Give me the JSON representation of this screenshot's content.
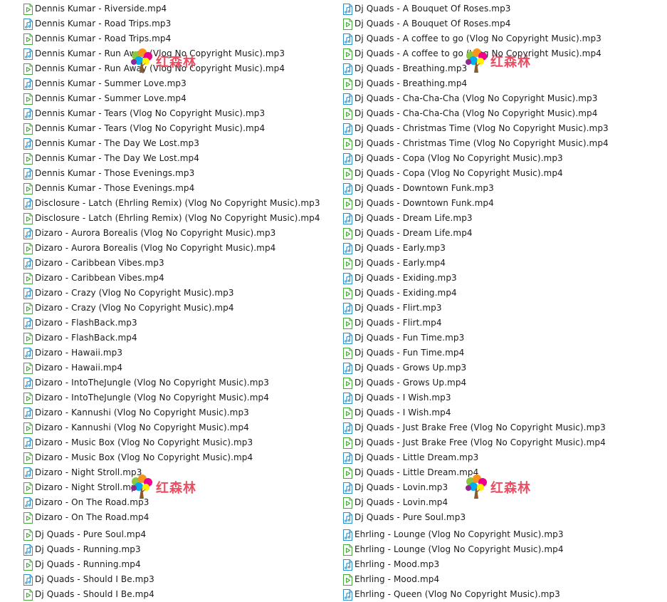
{
  "icons": {
    "mp3": "music-file-icon",
    "mp4": "video-file-icon"
  },
  "colors": {
    "mp3_icon": "#2b8fc9",
    "mp4_icon": "#46a83a",
    "watermark": "#e8455a"
  },
  "watermark_text": "红森林",
  "left_column": [
    {
      "name": "Dennis Kumar - Riverside.mp4",
      "type": "mp4"
    },
    {
      "name": "Dennis Kumar - Road Trips.mp3",
      "type": "mp3"
    },
    {
      "name": "Dennis Kumar - Road Trips.mp4",
      "type": "mp4"
    },
    {
      "name": "Dennis Kumar - Run Away (Vlog No Copyright Music).mp3",
      "type": "mp3"
    },
    {
      "name": "Dennis Kumar - Run Away (Vlog No Copyright Music).mp4",
      "type": "mp4"
    },
    {
      "name": "Dennis Kumar - Summer Love.mp3",
      "type": "mp3"
    },
    {
      "name": "Dennis Kumar - Summer Love.mp4",
      "type": "mp4"
    },
    {
      "name": "Dennis Kumar - Tears (Vlog No Copyright Music).mp3",
      "type": "mp3"
    },
    {
      "name": "Dennis Kumar - Tears (Vlog No Copyright Music).mp4",
      "type": "mp4"
    },
    {
      "name": "Dennis Kumar - The Day We Lost.mp3",
      "type": "mp3"
    },
    {
      "name": "Dennis Kumar - The Day We Lost.mp4",
      "type": "mp4"
    },
    {
      "name": "Dennis Kumar - Those Evenings.mp3",
      "type": "mp3"
    },
    {
      "name": "Dennis Kumar - Those Evenings.mp4",
      "type": "mp4"
    },
    {
      "name": "Disclosure - Latch (Ehrling Remix) (Vlog No Copyright Music).mp3",
      "type": "mp3"
    },
    {
      "name": "Disclosure - Latch (Ehrling Remix) (Vlog No Copyright Music).mp4",
      "type": "mp4"
    },
    {
      "name": "Dizaro - Aurora Borealis (Vlog No Copyright Music).mp3",
      "type": "mp3"
    },
    {
      "name": "Dizaro - Aurora Borealis (Vlog No Copyright Music).mp4",
      "type": "mp4"
    },
    {
      "name": "Dizaro - Caribbean Vibes.mp3",
      "type": "mp3"
    },
    {
      "name": "Dizaro - Caribbean Vibes.mp4",
      "type": "mp4"
    },
    {
      "name": "Dizaro - Crazy (Vlog No Copyright Music).mp3",
      "type": "mp3"
    },
    {
      "name": "Dizaro - Crazy (Vlog No Copyright Music).mp4",
      "type": "mp4"
    },
    {
      "name": "Dizaro - FlashBack.mp3",
      "type": "mp3"
    },
    {
      "name": "Dizaro - FlashBack.mp4",
      "type": "mp4"
    },
    {
      "name": "Dizaro - Hawaii.mp3",
      "type": "mp3"
    },
    {
      "name": "Dizaro - Hawaii.mp4",
      "type": "mp4"
    },
    {
      "name": "Dizaro - IntoTheJungle (Vlog No Copyright Music).mp3",
      "type": "mp3"
    },
    {
      "name": "Dizaro - IntoTheJungle (Vlog No Copyright Music).mp4",
      "type": "mp4"
    },
    {
      "name": "Dizaro - Kannushi (Vlog No Copyright Music).mp3",
      "type": "mp3"
    },
    {
      "name": "Dizaro - Kannushi (Vlog No Copyright Music).mp4",
      "type": "mp4"
    },
    {
      "name": "Dizaro - Music Box (Vlog No Copyright Music).mp3",
      "type": "mp3"
    },
    {
      "name": "Dizaro - Music Box (Vlog No Copyright Music).mp4",
      "type": "mp4"
    },
    {
      "name": "Dizaro - Night Stroll.mp3",
      "type": "mp3"
    },
    {
      "name": "Dizaro - Night Stroll.mp4",
      "type": "mp4"
    },
    {
      "name": "Dizaro - On The Road.mp3",
      "type": "mp3"
    },
    {
      "name": "Dizaro - On The Road.mp4",
      "type": "mp4"
    },
    {
      "name": "Dj Quads - Pure Soul.mp4",
      "type": "mp4"
    },
    {
      "name": "Dj Quads - Running.mp3",
      "type": "mp3"
    },
    {
      "name": "Dj Quads - Running.mp4",
      "type": "mp4"
    },
    {
      "name": "Dj Quads - Should I Be.mp3",
      "type": "mp3"
    },
    {
      "name": "Dj Quads - Should I Be.mp4",
      "type": "mp4"
    }
  ],
  "right_column": [
    {
      "name": "Dj Quads - A Bouquet Of Roses.mp3",
      "type": "mp3"
    },
    {
      "name": "Dj Quads - A Bouquet Of Roses.mp4",
      "type": "mp4"
    },
    {
      "name": "Dj Quads - A coffee to go (Vlog No Copyright Music).mp3",
      "type": "mp3"
    },
    {
      "name": "Dj Quads - A coffee to go (Vlog No Copyright Music).mp4",
      "type": "mp4"
    },
    {
      "name": "Dj Quads - Breathing.mp3",
      "type": "mp3"
    },
    {
      "name": "Dj Quads - Breathing.mp4",
      "type": "mp4"
    },
    {
      "name": "Dj Quads - Cha-Cha-Cha (Vlog No Copyright Music).mp3",
      "type": "mp3"
    },
    {
      "name": "Dj Quads - Cha-Cha-Cha (Vlog No Copyright Music).mp4",
      "type": "mp4"
    },
    {
      "name": "Dj Quads - Christmas Time (Vlog No Copyright Music).mp3",
      "type": "mp3"
    },
    {
      "name": "Dj Quads - Christmas Time (Vlog No Copyright Music).mp4",
      "type": "mp4"
    },
    {
      "name": "Dj Quads - Copa (Vlog No Copyright Music).mp3",
      "type": "mp3"
    },
    {
      "name": "Dj Quads - Copa (Vlog No Copyright Music).mp4",
      "type": "mp4"
    },
    {
      "name": "Dj Quads - Downtown Funk.mp3",
      "type": "mp3"
    },
    {
      "name": "Dj Quads - Downtown Funk.mp4",
      "type": "mp4"
    },
    {
      "name": "Dj Quads - Dream Life.mp3",
      "type": "mp3"
    },
    {
      "name": "Dj Quads - Dream Life.mp4",
      "type": "mp4"
    },
    {
      "name": "Dj Quads - Early.mp3",
      "type": "mp3"
    },
    {
      "name": "Dj Quads - Early.mp4",
      "type": "mp4"
    },
    {
      "name": "Dj Quads - Exiding.mp3",
      "type": "mp3"
    },
    {
      "name": "Dj Quads - Exiding.mp4",
      "type": "mp4"
    },
    {
      "name": "Dj Quads - Flirt.mp3",
      "type": "mp3"
    },
    {
      "name": "Dj Quads - Flirt.mp4",
      "type": "mp4"
    },
    {
      "name": "Dj Quads - Fun Time.mp3",
      "type": "mp3"
    },
    {
      "name": "Dj Quads - Fun Time.mp4",
      "type": "mp4"
    },
    {
      "name": "Dj Quads - Grows Up.mp3",
      "type": "mp3"
    },
    {
      "name": "Dj Quads - Grows Up.mp4",
      "type": "mp4"
    },
    {
      "name": "Dj Quads - I Wish.mp3",
      "type": "mp3"
    },
    {
      "name": "Dj Quads - I Wish.mp4",
      "type": "mp4"
    },
    {
      "name": "Dj Quads - Just Brake Free (Vlog No Copyright Music).mp3",
      "type": "mp3"
    },
    {
      "name": "Dj Quads - Just Brake Free (Vlog No Copyright Music).mp4",
      "type": "mp4"
    },
    {
      "name": "Dj Quads - Little Dream.mp3",
      "type": "mp3"
    },
    {
      "name": "Dj Quads - Little Dream.mp4",
      "type": "mp4"
    },
    {
      "name": "Dj Quads - Lovin.mp3",
      "type": "mp3"
    },
    {
      "name": "Dj Quads - Lovin.mp4",
      "type": "mp4"
    },
    {
      "name": "Dj Quads - Pure Soul.mp3",
      "type": "mp3"
    },
    {
      "name": "Ehrling - Lounge (Vlog No Copyright Music).mp3",
      "type": "mp3"
    },
    {
      "name": "Ehrling - Lounge (Vlog No Copyright Music).mp4",
      "type": "mp4"
    },
    {
      "name": "Ehrling - Mood.mp3",
      "type": "mp3"
    },
    {
      "name": "Ehrling - Mood.mp4",
      "type": "mp4"
    },
    {
      "name": "Ehrling - Queen (Vlog No Copyright Music).mp3",
      "type": "mp3"
    }
  ]
}
